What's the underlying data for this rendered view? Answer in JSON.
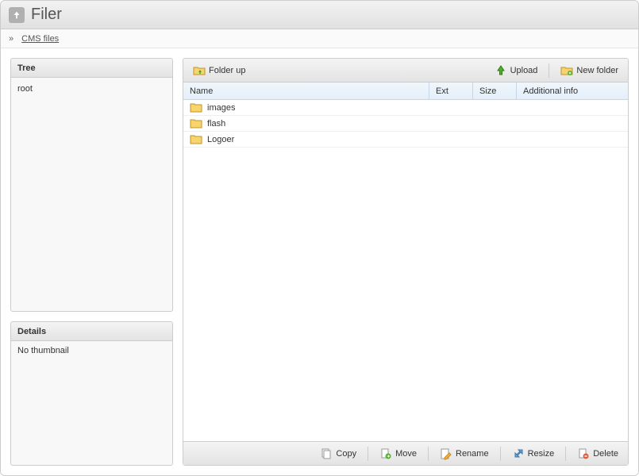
{
  "title": "Filer",
  "breadcrumb": {
    "sep": "»",
    "item": "CMS files"
  },
  "panels": {
    "tree": {
      "title": "Tree",
      "root": "root"
    },
    "details": {
      "title": "Details",
      "body": "No thumbnail"
    }
  },
  "toolbar_top": {
    "folder_up": "Folder up",
    "upload": "Upload",
    "new_folder": "New folder"
  },
  "columns": {
    "name": "Name",
    "ext": "Ext",
    "size": "Size",
    "info": "Additional info"
  },
  "files": [
    {
      "name": "images",
      "ext": "",
      "size": "",
      "info": ""
    },
    {
      "name": "flash",
      "ext": "",
      "size": "",
      "info": ""
    },
    {
      "name": "Logoer",
      "ext": "",
      "size": "",
      "info": ""
    }
  ],
  "toolbar_bottom": {
    "copy": "Copy",
    "move": "Move",
    "rename": "Rename",
    "resize": "Resize",
    "delete": "Delete"
  }
}
